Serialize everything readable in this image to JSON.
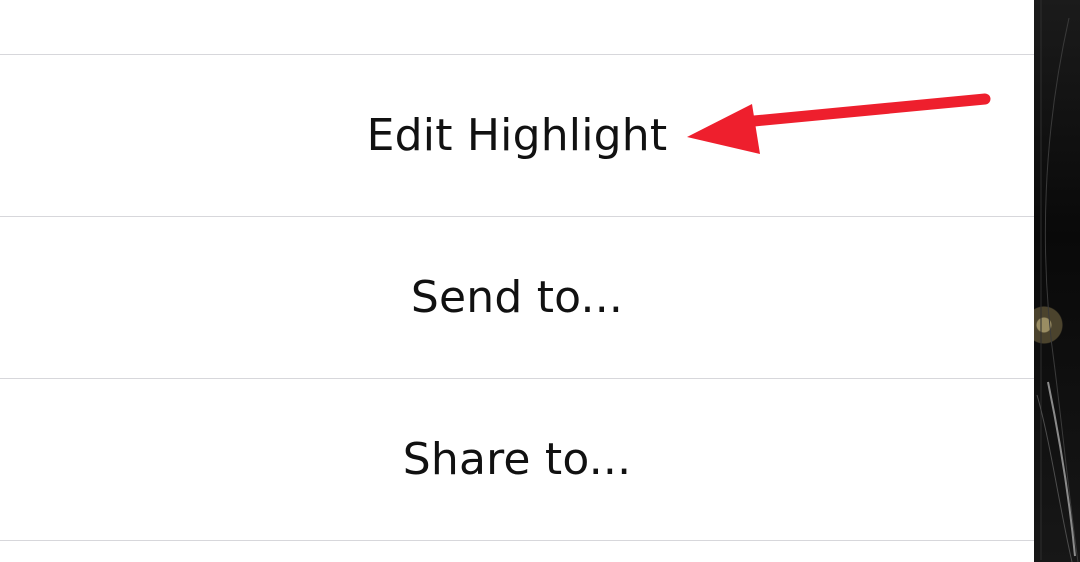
{
  "action_sheet": {
    "items": [
      {
        "label": "Edit Highlight"
      },
      {
        "label": "Send to..."
      },
      {
        "label": "Share to..."
      }
    ]
  },
  "colors": {
    "sheet_background": "#ffffff",
    "text": "#111111",
    "divider": "#d7d7db",
    "annotation_arrow": "#ee1f2d",
    "background_photo": "#0b0b0b"
  },
  "icons": {
    "annotation": "red-arrow-icon"
  }
}
